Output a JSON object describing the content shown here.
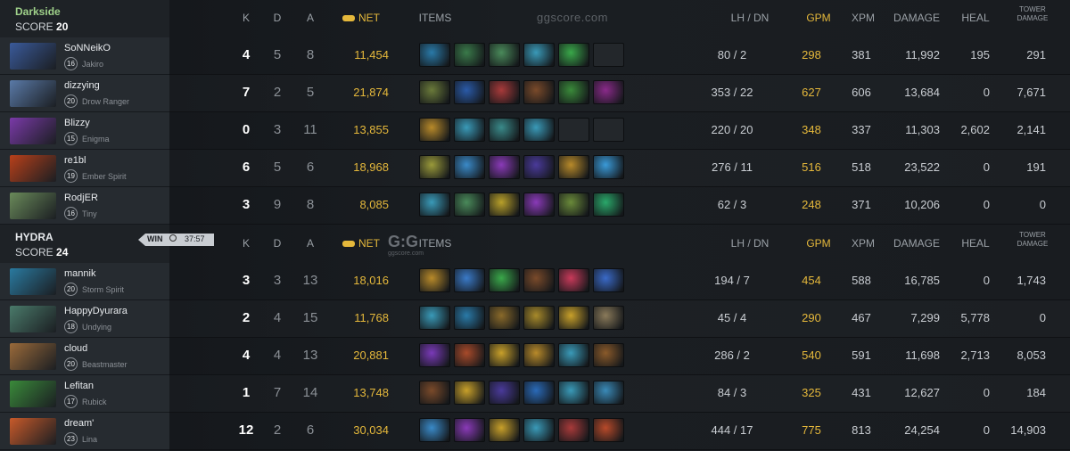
{
  "teams": [
    {
      "name": "Darkside",
      "score_label": "SCORE",
      "score": "20",
      "result": "",
      "header": {
        "k": "K",
        "d": "D",
        "a": "A",
        "net": "NET",
        "items": "ITEMS",
        "lhdn": "LH / DN",
        "gpm": "GPM",
        "xpm": "XPM",
        "damage": "DAMAGE",
        "heal": "HEAL",
        "tower1": "TOWER",
        "tower2": "DAMAGE",
        "watermark": "ggscore.com"
      },
      "players": [
        {
          "name": "SoNNeikO",
          "level": "16",
          "hero": "Jakiro",
          "k": "4",
          "d": "5",
          "a": "8",
          "net": "11,454",
          "lh": "80 / 2",
          "gpm": "298",
          "xpm": "381",
          "damage": "11,992",
          "heal": "195",
          "tower": "291",
          "portrait": "#3a5a9a"
        },
        {
          "name": "dizzying",
          "level": "20",
          "hero": "Drow Ranger",
          "k": "7",
          "d": "2",
          "a": "5",
          "net": "21,874",
          "lh": "353 / 22",
          "gpm": "627",
          "xpm": "606",
          "damage": "13,684",
          "heal": "0",
          "tower": "7,671",
          "portrait": "#5a7aa8"
        },
        {
          "name": "Blizzy",
          "level": "15",
          "hero": "Enigma",
          "k": "0",
          "d": "3",
          "a": "11",
          "net": "13,855",
          "lh": "220 / 20",
          "gpm": "348",
          "xpm": "337",
          "damage": "11,303",
          "heal": "2,602",
          "tower": "2,141",
          "portrait": "#7a3aa8"
        },
        {
          "name": "re1bl",
          "level": "19",
          "hero": "Ember Spirit",
          "k": "6",
          "d": "5",
          "a": "6",
          "net": "18,968",
          "lh": "276 / 11",
          "gpm": "516",
          "xpm": "518",
          "damage": "23,522",
          "heal": "0",
          "tower": "191",
          "portrait": "#b8401a"
        },
        {
          "name": "RodjER",
          "level": "16",
          "hero": "Tiny",
          "k": "3",
          "d": "9",
          "a": "8",
          "net": "8,085",
          "lh": "62 / 3",
          "gpm": "248",
          "xpm": "371",
          "damage": "10,206",
          "heal": "0",
          "tower": "0",
          "portrait": "#6a8a5a"
        }
      ]
    },
    {
      "name": "HYDRA",
      "score_label": "SCORE",
      "score": "24",
      "result": "WIN",
      "duration": "37:57",
      "header": {
        "k": "K",
        "d": "D",
        "a": "A",
        "net": "NET",
        "items": "ITEMS",
        "lhdn": "LH / DN",
        "gpm": "GPM",
        "xpm": "XPM",
        "damage": "DAMAGE",
        "heal": "HEAL",
        "tower1": "TOWER",
        "tower2": "DAMAGE",
        "logo": "G:G",
        "logo_sub": "ggscore.com"
      },
      "players": [
        {
          "name": "mannik",
          "level": "20",
          "hero": "Storm Spirit",
          "k": "3",
          "d": "3",
          "a": "13",
          "net": "18,016",
          "lh": "194 / 7",
          "gpm": "454",
          "xpm": "588",
          "damage": "16,785",
          "heal": "0",
          "tower": "1,743",
          "portrait": "#2a7aa0"
        },
        {
          "name": "HappyDyurara",
          "level": "18",
          "hero": "Undying",
          "k": "2",
          "d": "4",
          "a": "15",
          "net": "11,768",
          "lh": "45 / 4",
          "gpm": "290",
          "xpm": "467",
          "damage": "7,299",
          "heal": "5,778",
          "tower": "0",
          "portrait": "#4a7a6a"
        },
        {
          "name": "cloud",
          "level": "20",
          "hero": "Beastmaster",
          "k": "4",
          "d": "4",
          "a": "13",
          "net": "20,881",
          "lh": "286 / 2",
          "gpm": "540",
          "xpm": "591",
          "damage": "11,698",
          "heal": "2,713",
          "tower": "8,053",
          "portrait": "#9a6a3a"
        },
        {
          "name": "Lefitan",
          "level": "17",
          "hero": "Rubick",
          "k": "1",
          "d": "7",
          "a": "14",
          "net": "13,748",
          "lh": "84 / 3",
          "gpm": "325",
          "xpm": "431",
          "damage": "12,627",
          "heal": "0",
          "tower": "184",
          "portrait": "#3a8a3a"
        },
        {
          "name": "dream'",
          "level": "23",
          "hero": "Lina",
          "k": "12",
          "d": "2",
          "a": "6",
          "net": "30,034",
          "lh": "444 / 17",
          "gpm": "775",
          "xpm": "813",
          "damage": "24,254",
          "heal": "0",
          "tower": "14,903",
          "portrait": "#c85a2a"
        }
      ]
    }
  ],
  "item_colors": [
    [
      "#2a7aa8",
      "#3a7a4a",
      "#4a8a5a",
      "#3a9ab8",
      "#3aa84a",
      ""
    ],
    [
      "#6a7a3a",
      "#2a5aa8",
      "#a83a3a",
      "#7a4a2a",
      "#3a8a3a",
      "#8a2a8a"
    ],
    [
      "#b88a2a",
      "#3a9ab8",
      "#3a8a8a",
      "#3a9ab8",
      "",
      ""
    ],
    [
      "#9a9a3a",
      "#3a8ac8",
      "#8a3ab8",
      "#4a3a9a",
      "#b88a2a",
      "#3a9ad8"
    ],
    [
      "#3a9ab8",
      "#4a8a5a",
      "#b8a02a",
      "#8a3ab8",
      "#6a8a3a",
      "#2aa86a"
    ],
    [
      "#b88a2a",
      "#3a7ac8",
      "#3aa84a",
      "#7a4a2a",
      "#c83a5a",
      "#3a6ac8"
    ],
    [
      "#3a9ab8",
      "#2a7aa8",
      "#8a6a2a",
      "#a88a2a",
      "#c8a02a",
      "#8a7a5a"
    ],
    [
      "#7a3ab8",
      "#a84a2a",
      "#c8a02a",
      "#b88a2a",
      "#3a9ab8",
      "#8a5a2a"
    ],
    [
      "#7a4a2a",
      "#c8a02a",
      "#4a3a9a",
      "#2a6ab8",
      "#3a9ab8",
      "#3a8ab8"
    ],
    [
      "#3a8ac8",
      "#8a3ab8",
      "#c8a02a",
      "#3a9ab8",
      "#a83a3a",
      "#b84a2a"
    ]
  ]
}
